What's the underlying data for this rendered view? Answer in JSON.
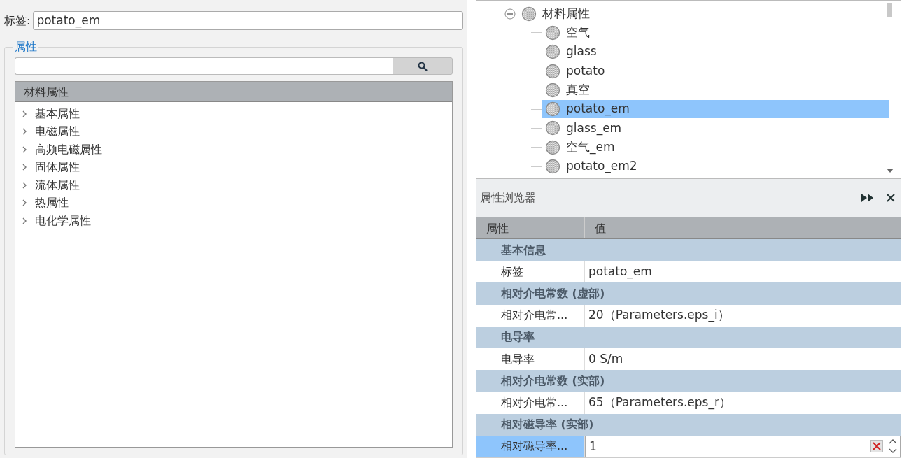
{
  "label_field": {
    "label": "标签:",
    "value": "potato_em"
  },
  "properties_group": {
    "title": "属性",
    "tree": {
      "header": "材料属性",
      "items": [
        {
          "label": "基本属性",
          "expanded": false
        },
        {
          "label": "电磁属性",
          "expanded": false
        },
        {
          "label": "高频电磁属性",
          "expanded": false
        },
        {
          "label": "固体属性",
          "expanded": false
        },
        {
          "label": "流体属性",
          "expanded": false
        },
        {
          "label": "热属性",
          "expanded": false
        },
        {
          "label": "电化学属性",
          "expanded": false
        }
      ]
    }
  },
  "material_tree": {
    "root": {
      "label": "材料属性",
      "expanded": true,
      "children": [
        {
          "label": "空气",
          "selected": false
        },
        {
          "label": "glass",
          "selected": false
        },
        {
          "label": "potato",
          "selected": false
        },
        {
          "label": "真空",
          "selected": false
        },
        {
          "label": "potato_em",
          "selected": true
        },
        {
          "label": "glass_em",
          "selected": false
        },
        {
          "label": "空气_em",
          "selected": false
        },
        {
          "label": "potato_em2",
          "selected": false
        }
      ]
    }
  },
  "property_browser": {
    "title": "属性浏览器",
    "columns": [
      "属性",
      "值"
    ],
    "rows": [
      {
        "kind": "group",
        "label": "基本信息"
      },
      {
        "kind": "property",
        "name": "标签",
        "value": "potato_em",
        "selected": false
      },
      {
        "kind": "group",
        "label": "相对介电常数 (虚部)"
      },
      {
        "kind": "property",
        "name": "相对介电常...",
        "value": "20（Parameters.eps_i）",
        "selected": false
      },
      {
        "kind": "group",
        "label": "电导率"
      },
      {
        "kind": "property",
        "name": "电导率",
        "value": "0 S/m",
        "selected": false
      },
      {
        "kind": "group",
        "label": "相对介电常数 (实部)"
      },
      {
        "kind": "property",
        "name": "相对介电常...",
        "value": "65（Parameters.eps_r）",
        "selected": false
      },
      {
        "kind": "group",
        "label": "相对磁导率 (实部)"
      },
      {
        "kind": "property",
        "name": "相对磁导率...",
        "value": "1",
        "selected": true
      }
    ]
  }
}
